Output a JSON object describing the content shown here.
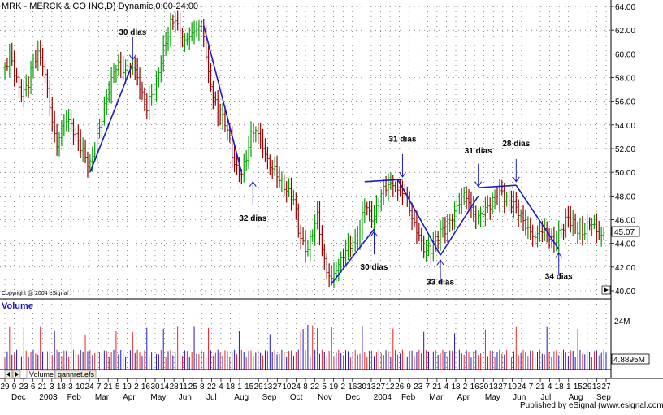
{
  "chart_data": {
    "type": "ohlc-bar",
    "title": "MRK - MERCK & CO INC,D) Dynamic,0:00-24:00",
    "copyright": "Copyright @ 2004 eSignal",
    "publisher": "Published by eSignal (www.esignal.com)",
    "last_price": "45.07",
    "price_axis": {
      "ylim": [
        40,
        64
      ],
      "ticks": [
        "40.00",
        "42.00",
        "44.00",
        "46.00",
        "48.00",
        "50.00",
        "52.00",
        "54.00",
        "56.00",
        "58.00",
        "60.00",
        "62.00",
        "64.00"
      ]
    },
    "volume_panel": {
      "title": "Volume",
      "ticks": [
        "24M"
      ],
      "last_value": "4.8895M",
      "tabs": [
        "Volume",
        "gannret.efs"
      ]
    },
    "x_day_ticks": [
      "29",
      "9",
      "23",
      "6",
      "21",
      "3",
      "18",
      "3",
      "10",
      "24",
      "7",
      "21",
      "5",
      "19",
      "2",
      "16",
      "30",
      "14",
      "28",
      "11",
      "25",
      "8",
      "22",
      "4",
      "18",
      "1",
      "15",
      "29",
      "13",
      "27",
      "10",
      "24",
      "8",
      "22",
      "5",
      "19",
      "2",
      "16",
      "30",
      "13",
      "27",
      "12",
      "26",
      "9",
      "23",
      "7",
      "21",
      "4",
      "18",
      "2",
      "16",
      "30",
      "13",
      "27",
      "10",
      "24",
      "7",
      "21",
      "4",
      "18",
      "1",
      "15",
      "29",
      "13",
      "27"
    ],
    "x_month_ticks": [
      "Dec",
      "2003",
      "Feb",
      "Mar",
      "Apr",
      "May",
      "Jun",
      "Jul",
      "Aug",
      "Sep",
      "Oct",
      "Nov",
      "Dec",
      "2004",
      "Feb",
      "Mar",
      "Apr",
      "May",
      "Jun",
      "Jul",
      "Aug",
      "Sep"
    ],
    "price_series": [
      {
        "d": 0,
        "p": 58.8
      },
      {
        "d": 5,
        "p": 59.8
      },
      {
        "d": 10,
        "p": 58.6
      },
      {
        "d": 15,
        "p": 57.0
      },
      {
        "d": 20,
        "p": 56.7
      },
      {
        "d": 25,
        "p": 57.6
      },
      {
        "d": 30,
        "p": 59.5
      },
      {
        "d": 35,
        "p": 60.0
      },
      {
        "d": 40,
        "p": 59.2
      },
      {
        "d": 45,
        "p": 57.0
      },
      {
        "d": 50,
        "p": 54.2
      },
      {
        "d": 55,
        "p": 52.2
      },
      {
        "d": 60,
        "p": 53.8
      },
      {
        "d": 65,
        "p": 54.5
      },
      {
        "d": 70,
        "p": 54.0
      },
      {
        "d": 75,
        "p": 53.0
      },
      {
        "d": 80,
        "p": 52.2
      },
      {
        "d": 85,
        "p": 51.2
      },
      {
        "d": 90,
        "p": 50.6
      },
      {
        "d": 95,
        "p": 52.0
      },
      {
        "d": 100,
        "p": 53.8
      },
      {
        "d": 105,
        "p": 55.5
      },
      {
        "d": 110,
        "p": 57.0
      },
      {
        "d": 115,
        "p": 58.5
      },
      {
        "d": 120,
        "p": 59.2
      },
      {
        "d": 125,
        "p": 58.5
      },
      {
        "d": 130,
        "p": 58.8
      },
      {
        "d": 135,
        "p": 59.0
      },
      {
        "d": 140,
        "p": 58.0
      },
      {
        "d": 145,
        "p": 56.5
      },
      {
        "d": 150,
        "p": 55.5
      },
      {
        "d": 155,
        "p": 56.6
      },
      {
        "d": 160,
        "p": 57.5
      },
      {
        "d": 165,
        "p": 59.5
      },
      {
        "d": 170,
        "p": 61.0
      },
      {
        "d": 175,
        "p": 62.5
      },
      {
        "d": 180,
        "p": 63.0
      },
      {
        "d": 185,
        "p": 61.5
      },
      {
        "d": 190,
        "p": 61.0
      },
      {
        "d": 195,
        "p": 61.6
      },
      {
        "d": 200,
        "p": 61.8
      },
      {
        "d": 205,
        "p": 62.4
      },
      {
        "d": 210,
        "p": 61.6
      },
      {
        "d": 215,
        "p": 58.2
      },
      {
        "d": 220,
        "p": 56.5
      },
      {
        "d": 225,
        "p": 55.0
      },
      {
        "d": 230,
        "p": 54.5
      },
      {
        "d": 235,
        "p": 53.8
      },
      {
        "d": 240,
        "p": 51.5
      },
      {
        "d": 245,
        "p": 50.2
      },
      {
        "d": 250,
        "p": 50.0
      },
      {
        "d": 255,
        "p": 51.2
      },
      {
        "d": 260,
        "p": 53.2
      },
      {
        "d": 265,
        "p": 53.6
      },
      {
        "d": 270,
        "p": 52.7
      },
      {
        "d": 275,
        "p": 51.5
      },
      {
        "d": 280,
        "p": 50.5
      },
      {
        "d": 285,
        "p": 50.2
      },
      {
        "d": 290,
        "p": 49.4
      },
      {
        "d": 295,
        "p": 48.8
      },
      {
        "d": 300,
        "p": 48.2
      },
      {
        "d": 305,
        "p": 47.8
      },
      {
        "d": 310,
        "p": 45.2
      },
      {
        "d": 315,
        "p": 43.8
      },
      {
        "d": 320,
        "p": 43.5
      },
      {
        "d": 325,
        "p": 45.0
      },
      {
        "d": 330,
        "p": 46.4
      },
      {
        "d": 335,
        "p": 43.5
      },
      {
        "d": 340,
        "p": 41.6
      },
      {
        "d": 345,
        "p": 41.0
      },
      {
        "d": 350,
        "p": 41.8
      },
      {
        "d": 355,
        "p": 42.6
      },
      {
        "d": 360,
        "p": 43.4
      },
      {
        "d": 365,
        "p": 43.9
      },
      {
        "d": 370,
        "p": 44.3
      },
      {
        "d": 375,
        "p": 45.0
      },
      {
        "d": 380,
        "p": 47.5
      },
      {
        "d": 385,
        "p": 46.4
      },
      {
        "d": 390,
        "p": 46.2
      },
      {
        "d": 395,
        "p": 47.6
      },
      {
        "d": 400,
        "p": 48.6
      },
      {
        "d": 405,
        "p": 48.9
      },
      {
        "d": 410,
        "p": 49.0
      },
      {
        "d": 415,
        "p": 48.4
      },
      {
        "d": 420,
        "p": 48.3
      },
      {
        "d": 425,
        "p": 47.9
      },
      {
        "d": 430,
        "p": 46.0
      },
      {
        "d": 435,
        "p": 45.2
      },
      {
        "d": 440,
        "p": 44.0
      },
      {
        "d": 445,
        "p": 43.4
      },
      {
        "d": 450,
        "p": 43.6
      },
      {
        "d": 455,
        "p": 44.3
      },
      {
        "d": 460,
        "p": 45.0
      },
      {
        "d": 465,
        "p": 45.2
      },
      {
        "d": 470,
        "p": 45.8
      },
      {
        "d": 475,
        "p": 46.6
      },
      {
        "d": 480,
        "p": 47.5
      },
      {
        "d": 485,
        "p": 48.2
      },
      {
        "d": 490,
        "p": 47.5
      },
      {
        "d": 495,
        "p": 46.4
      },
      {
        "d": 500,
        "p": 46.2
      },
      {
        "d": 505,
        "p": 46.7
      },
      {
        "d": 510,
        "p": 47.0
      },
      {
        "d": 515,
        "p": 47.6
      },
      {
        "d": 520,
        "p": 48.0
      },
      {
        "d": 525,
        "p": 48.3
      },
      {
        "d": 530,
        "p": 47.6
      },
      {
        "d": 535,
        "p": 47.4
      },
      {
        "d": 540,
        "p": 47.0
      },
      {
        "d": 545,
        "p": 46.3
      },
      {
        "d": 550,
        "p": 45.5
      },
      {
        "d": 555,
        "p": 44.9
      },
      {
        "d": 560,
        "p": 44.5
      },
      {
        "d": 565,
        "p": 45.0
      },
      {
        "d": 570,
        "p": 45.1
      },
      {
        "d": 575,
        "p": 44.6
      },
      {
        "d": 580,
        "p": 44.0
      },
      {
        "d": 585,
        "p": 44.8
      },
      {
        "d": 590,
        "p": 45.5
      },
      {
        "d": 595,
        "p": 46.2
      },
      {
        "d": 600,
        "p": 45.6
      },
      {
        "d": 605,
        "p": 45.2
      },
      {
        "d": 610,
        "p": 44.8
      },
      {
        "d": 615,
        "p": 45.4
      },
      {
        "d": 620,
        "p": 45.8
      },
      {
        "d": 625,
        "p": 45.0
      },
      {
        "d": 630,
        "p": 44.6
      },
      {
        "d": 635,
        "p": 45.07
      }
    ],
    "trendlines": [
      {
        "from": {
          "d": 90,
          "p": 50.0
        },
        "to": {
          "d": 135,
          "p": 59.2
        }
      },
      {
        "from": {
          "d": 210,
          "p": 62.4
        },
        "to": {
          "d": 250,
          "p": 50.0
        }
      },
      {
        "from": {
          "d": 345,
          "p": 40.6
        },
        "to": {
          "d": 390,
          "p": 45.2
        }
      },
      {
        "from": {
          "d": 380,
          "p": 49.2
        },
        "to": {
          "d": 420,
          "p": 49.4
        }
      },
      {
        "from": {
          "d": 415,
          "p": 49.4
        },
        "to": {
          "d": 460,
          "p": 43.0
        }
      },
      {
        "from": {
          "d": 460,
          "p": 43.0
        },
        "to": {
          "d": 500,
          "p": 48.0
        }
      },
      {
        "from": {
          "d": 500,
          "p": 48.7
        },
        "to": {
          "d": 540,
          "p": 48.9
        }
      },
      {
        "from": {
          "d": 540,
          "p": 48.9
        },
        "to": {
          "d": 585,
          "p": 43.5
        }
      }
    ],
    "annotations": [
      {
        "text": "30 dias",
        "d": 135,
        "p": 59.5,
        "dir": "down",
        "label_p": 61.6
      },
      {
        "text": "32 dias",
        "d": 262,
        "p": 49.2,
        "dir": "up",
        "label_p": 45.9
      },
      {
        "text": "30 dias",
        "d": 390,
        "p": 45.0,
        "dir": "up",
        "label_p": 41.8
      },
      {
        "text": "31 dias",
        "d": 420,
        "p": 49.6,
        "dir": "down",
        "label_p": 52.6
      },
      {
        "text": "33 dias",
        "d": 460,
        "p": 42.6,
        "dir": "up",
        "label_p": 40.5
      },
      {
        "text": "31 dias",
        "d": 500,
        "p": 48.8,
        "dir": "down",
        "label_p": 51.6
      },
      {
        "text": "28 dias",
        "d": 540,
        "p": 49.2,
        "dir": "down",
        "label_p": 52.2
      },
      {
        "text": "34 dias",
        "d": 585,
        "p": 43.2,
        "dir": "up",
        "label_p": 41.0
      }
    ]
  }
}
